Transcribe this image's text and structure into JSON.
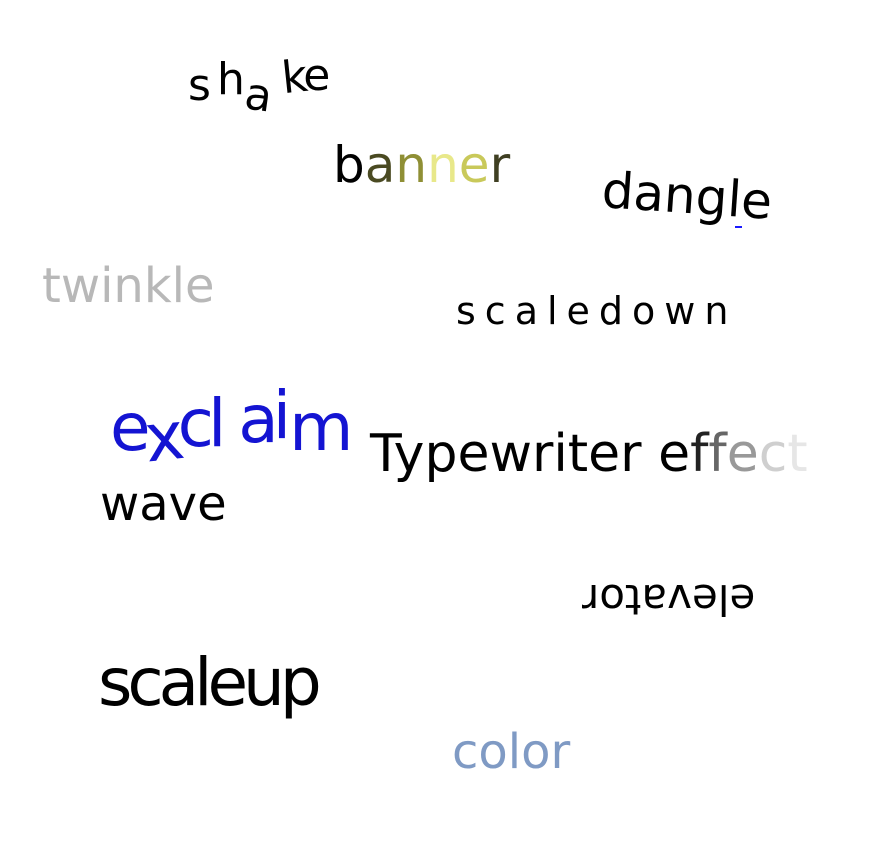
{
  "words": {
    "shake": [
      "s",
      "h",
      "a",
      "k",
      "e"
    ],
    "banner": {
      "letters": [
        "b",
        "a",
        "n",
        "n",
        "e",
        "r"
      ],
      "colors": [
        "#000000",
        "#4a4a22",
        "#8f8f35",
        "#e8e88a",
        "#c9c95a",
        "#3f3f22"
      ]
    },
    "dangle": "dangle",
    "twinkle": "twinkle",
    "scaledown": "scaledown",
    "exclaim": [
      "e",
      "x",
      "cl",
      "a",
      "i",
      "m"
    ],
    "wave": "wave",
    "typewriter": {
      "lead": "Typewriter e",
      "fade_letters": [
        "f",
        "f",
        "e",
        "c",
        "t"
      ],
      "fade_colors": [
        "#222222",
        "#666666",
        "#999999",
        "#cfcfcf",
        "#e6e6e6"
      ]
    },
    "elevator": "elevator",
    "scaleup": "scaleup",
    "color": "color"
  }
}
